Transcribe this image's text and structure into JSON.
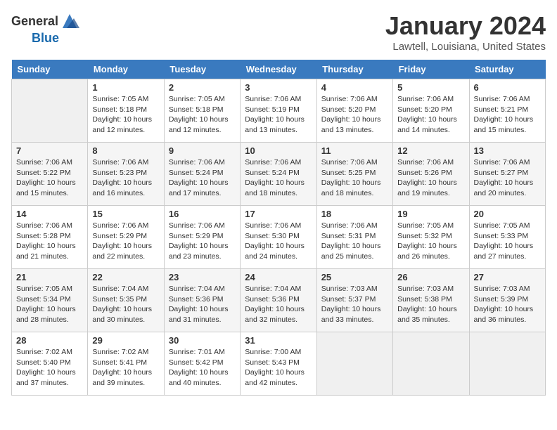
{
  "header": {
    "logo_general": "General",
    "logo_blue": "Blue",
    "title": "January 2024",
    "subtitle": "Lawtell, Louisiana, United States"
  },
  "calendar": {
    "days_of_week": [
      "Sunday",
      "Monday",
      "Tuesday",
      "Wednesday",
      "Thursday",
      "Friday",
      "Saturday"
    ],
    "weeks": [
      [
        {
          "day": "",
          "info": ""
        },
        {
          "day": "1",
          "info": "Sunrise: 7:05 AM\nSunset: 5:18 PM\nDaylight: 10 hours\nand 12 minutes."
        },
        {
          "day": "2",
          "info": "Sunrise: 7:05 AM\nSunset: 5:18 PM\nDaylight: 10 hours\nand 12 minutes."
        },
        {
          "day": "3",
          "info": "Sunrise: 7:06 AM\nSunset: 5:19 PM\nDaylight: 10 hours\nand 13 minutes."
        },
        {
          "day": "4",
          "info": "Sunrise: 7:06 AM\nSunset: 5:20 PM\nDaylight: 10 hours\nand 13 minutes."
        },
        {
          "day": "5",
          "info": "Sunrise: 7:06 AM\nSunset: 5:20 PM\nDaylight: 10 hours\nand 14 minutes."
        },
        {
          "day": "6",
          "info": "Sunrise: 7:06 AM\nSunset: 5:21 PM\nDaylight: 10 hours\nand 15 minutes."
        }
      ],
      [
        {
          "day": "7",
          "info": "Sunrise: 7:06 AM\nSunset: 5:22 PM\nDaylight: 10 hours\nand 15 minutes."
        },
        {
          "day": "8",
          "info": "Sunrise: 7:06 AM\nSunset: 5:23 PM\nDaylight: 10 hours\nand 16 minutes."
        },
        {
          "day": "9",
          "info": "Sunrise: 7:06 AM\nSunset: 5:24 PM\nDaylight: 10 hours\nand 17 minutes."
        },
        {
          "day": "10",
          "info": "Sunrise: 7:06 AM\nSunset: 5:24 PM\nDaylight: 10 hours\nand 18 minutes."
        },
        {
          "day": "11",
          "info": "Sunrise: 7:06 AM\nSunset: 5:25 PM\nDaylight: 10 hours\nand 18 minutes."
        },
        {
          "day": "12",
          "info": "Sunrise: 7:06 AM\nSunset: 5:26 PM\nDaylight: 10 hours\nand 19 minutes."
        },
        {
          "day": "13",
          "info": "Sunrise: 7:06 AM\nSunset: 5:27 PM\nDaylight: 10 hours\nand 20 minutes."
        }
      ],
      [
        {
          "day": "14",
          "info": "Sunrise: 7:06 AM\nSunset: 5:28 PM\nDaylight: 10 hours\nand 21 minutes."
        },
        {
          "day": "15",
          "info": "Sunrise: 7:06 AM\nSunset: 5:29 PM\nDaylight: 10 hours\nand 22 minutes."
        },
        {
          "day": "16",
          "info": "Sunrise: 7:06 AM\nSunset: 5:29 PM\nDaylight: 10 hours\nand 23 minutes."
        },
        {
          "day": "17",
          "info": "Sunrise: 7:06 AM\nSunset: 5:30 PM\nDaylight: 10 hours\nand 24 minutes."
        },
        {
          "day": "18",
          "info": "Sunrise: 7:06 AM\nSunset: 5:31 PM\nDaylight: 10 hours\nand 25 minutes."
        },
        {
          "day": "19",
          "info": "Sunrise: 7:05 AM\nSunset: 5:32 PM\nDaylight: 10 hours\nand 26 minutes."
        },
        {
          "day": "20",
          "info": "Sunrise: 7:05 AM\nSunset: 5:33 PM\nDaylight: 10 hours\nand 27 minutes."
        }
      ],
      [
        {
          "day": "21",
          "info": "Sunrise: 7:05 AM\nSunset: 5:34 PM\nDaylight: 10 hours\nand 28 minutes."
        },
        {
          "day": "22",
          "info": "Sunrise: 7:04 AM\nSunset: 5:35 PM\nDaylight: 10 hours\nand 30 minutes."
        },
        {
          "day": "23",
          "info": "Sunrise: 7:04 AM\nSunset: 5:36 PM\nDaylight: 10 hours\nand 31 minutes."
        },
        {
          "day": "24",
          "info": "Sunrise: 7:04 AM\nSunset: 5:36 PM\nDaylight: 10 hours\nand 32 minutes."
        },
        {
          "day": "25",
          "info": "Sunrise: 7:03 AM\nSunset: 5:37 PM\nDaylight: 10 hours\nand 33 minutes."
        },
        {
          "day": "26",
          "info": "Sunrise: 7:03 AM\nSunset: 5:38 PM\nDaylight: 10 hours\nand 35 minutes."
        },
        {
          "day": "27",
          "info": "Sunrise: 7:03 AM\nSunset: 5:39 PM\nDaylight: 10 hours\nand 36 minutes."
        }
      ],
      [
        {
          "day": "28",
          "info": "Sunrise: 7:02 AM\nSunset: 5:40 PM\nDaylight: 10 hours\nand 37 minutes."
        },
        {
          "day": "29",
          "info": "Sunrise: 7:02 AM\nSunset: 5:41 PM\nDaylight: 10 hours\nand 39 minutes."
        },
        {
          "day": "30",
          "info": "Sunrise: 7:01 AM\nSunset: 5:42 PM\nDaylight: 10 hours\nand 40 minutes."
        },
        {
          "day": "31",
          "info": "Sunrise: 7:00 AM\nSunset: 5:43 PM\nDaylight: 10 hours\nand 42 minutes."
        },
        {
          "day": "",
          "info": ""
        },
        {
          "day": "",
          "info": ""
        },
        {
          "day": "",
          "info": ""
        }
      ]
    ]
  }
}
